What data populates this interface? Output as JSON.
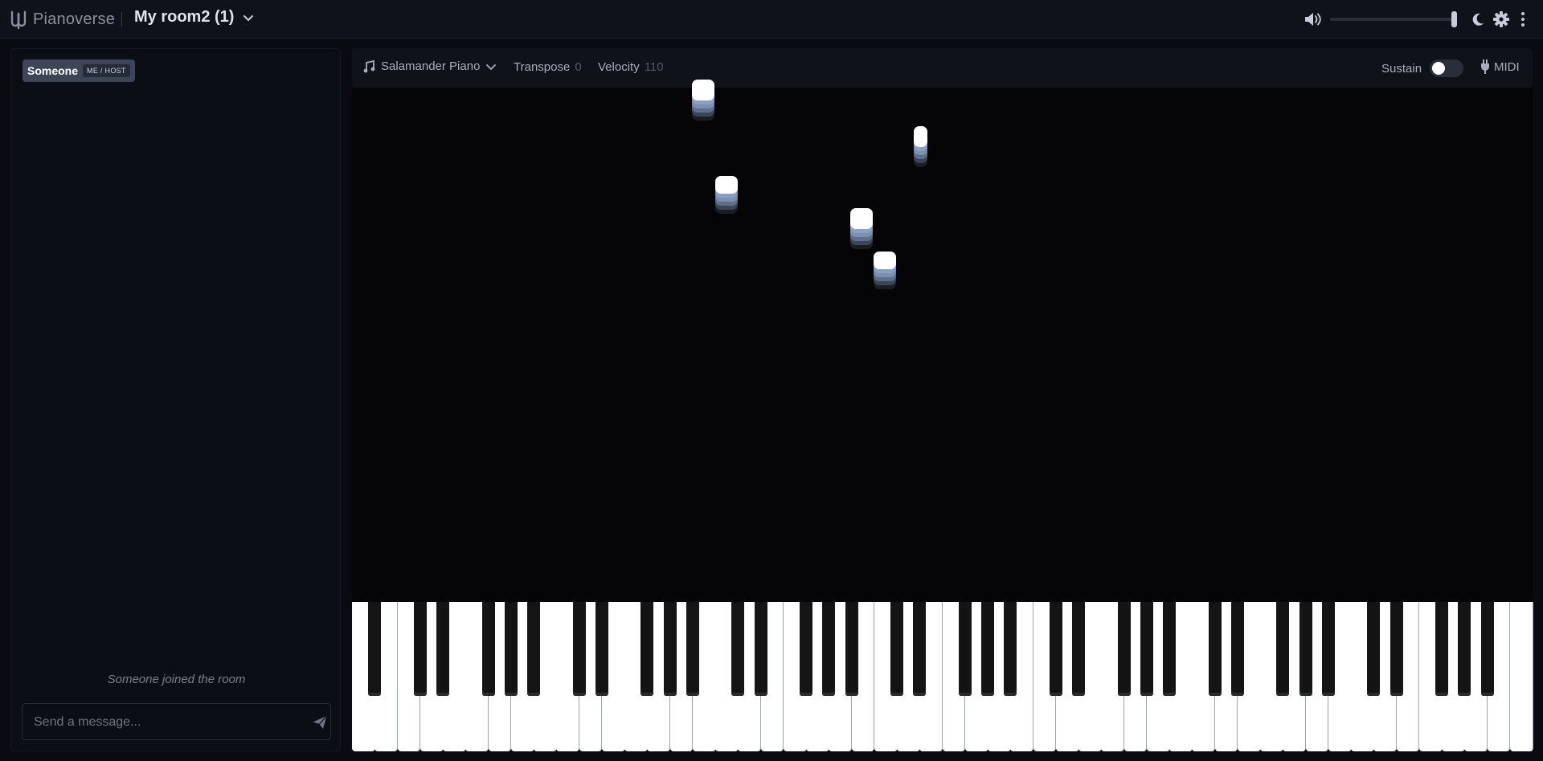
{
  "app": {
    "brand": "Pianoverse",
    "room_title": "My room2 (1)",
    "icons": {
      "logo": "pianoverse-logo-icon",
      "room_menu": "chevron-down-icon",
      "volume": "volume-icon",
      "theme": "moon-icon",
      "settings": "gear-icon",
      "more": "kebab-menu-icon"
    },
    "volume_level": 1.0
  },
  "sidebar": {
    "user": {
      "name": "Someone",
      "badge": "ME / HOST"
    },
    "system_message": "Someone joined the room",
    "chat_input": {
      "placeholder": "Send a message...",
      "value": ""
    },
    "send_icon": "send-icon"
  },
  "toolbar": {
    "instrument": "Salamander Piano",
    "instrument_icon": "music-note-icon",
    "transpose_label": "Transpose",
    "transpose_value": "0",
    "velocity_label": "Velocity",
    "velocity_value": "110",
    "sustain_label": "Sustain",
    "sustain_on": false,
    "midi_label": "MIDI",
    "midi_icon": "plug-icon"
  },
  "colors": {
    "background": "#0a0b10",
    "panel": "#10121a",
    "note_head": "#ffffff",
    "note_trail": "#8fa8cf"
  },
  "keyboard": {
    "white_keys": 52,
    "black_keys": 36
  }
}
